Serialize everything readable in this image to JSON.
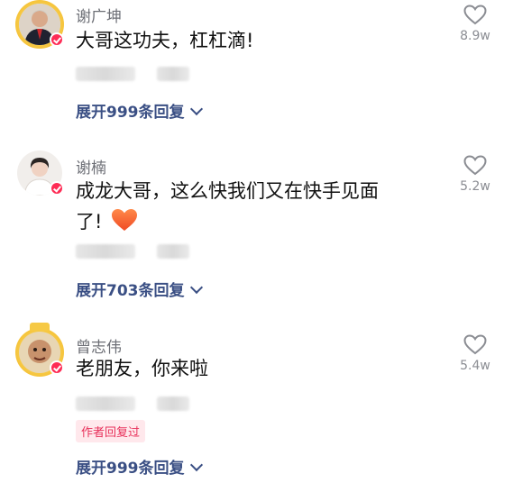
{
  "comments": [
    {
      "name": "谢广坤",
      "text": "大哥这功夫，杠杠滴!",
      "likes": "8.9w",
      "expand": "展开999条回复"
    },
    {
      "name": "谢楠",
      "text_line1": "成龙大哥，这么快我们又在快手见面",
      "text_line2": "了!",
      "emoji": "heart-emoji",
      "likes": "5.2w",
      "expand": "展开703条回复"
    },
    {
      "name": "曾志伟",
      "text": "老朋友，你来啦",
      "likes": "5.4w",
      "author_tag": "作者回复过",
      "expand": "展开999条回复"
    }
  ],
  "colors": {
    "accent_link": "#3a4f84",
    "badge": "#fe2c55",
    "author_tag": "#e8305a"
  }
}
